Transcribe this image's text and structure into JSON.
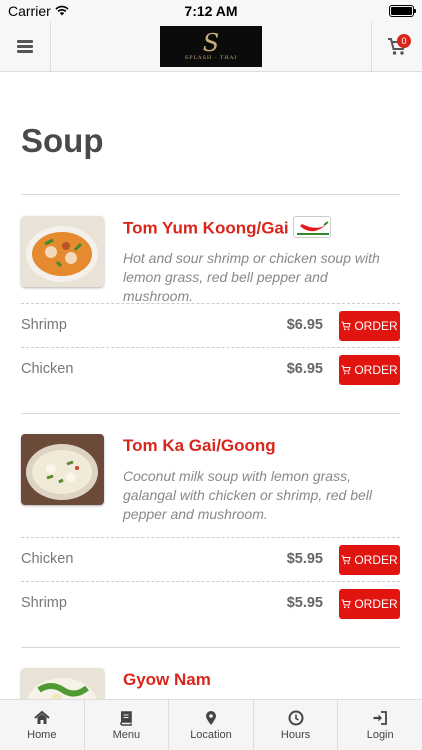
{
  "status": {
    "carrier": "Carrier",
    "time": "7:12 AM"
  },
  "header": {
    "logo_text": "SPLASH · THAI",
    "cart_count": "0"
  },
  "page": {
    "title": "Soup"
  },
  "items": [
    {
      "name": "Tom Yum Koong/Gai",
      "spicy": true,
      "description": "Hot and sour shrimp or chicken soup with lemon grass, red bell pepper and mushroom.",
      "options": [
        {
          "label": "Shrimp",
          "price": "$6.95",
          "button": "ORDER"
        },
        {
          "label": "Chicken",
          "price": "$6.95",
          "button": "ORDER"
        }
      ]
    },
    {
      "name": "Tom Ka Gai/Goong",
      "spicy": false,
      "description": "Coconut milk soup with lemon grass, galangal with chicken or shrimp, red bell pepper and mushroom.",
      "options": [
        {
          "label": "Chicken",
          "price": "$5.95",
          "button": "ORDER"
        },
        {
          "label": "Shrimp",
          "price": "$5.95",
          "button": "ORDER"
        }
      ]
    },
    {
      "name": "Gyow Nam",
      "spicy": false,
      "description": "",
      "options": []
    }
  ],
  "tabs": [
    {
      "label": "Home",
      "icon": "home-icon"
    },
    {
      "label": "Menu",
      "icon": "book-icon"
    },
    {
      "label": "Location",
      "icon": "map-pin-icon"
    },
    {
      "label": "Hours",
      "icon": "clock-icon"
    },
    {
      "label": "Login",
      "icon": "login-icon"
    }
  ]
}
